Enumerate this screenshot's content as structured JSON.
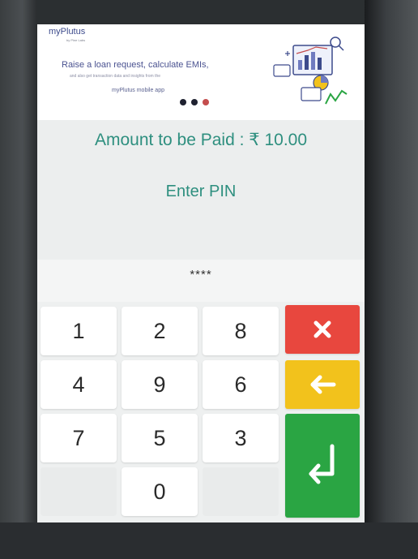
{
  "banner": {
    "brand": "myPlutus",
    "brand_sub": "by Pine Labs",
    "tagline": "Raise a loan request, calculate EMIs,",
    "tagline_sub": "and also get transaction data and insights from the",
    "app_line": "myPlutus mobile app",
    "carousel_active_index": 2,
    "carousel_count": 3
  },
  "payment": {
    "amount_label": "Amount to be Paid : ₹ 10.00",
    "enter_pin_label": "Enter PIN",
    "pin_mask": "****"
  },
  "keypad": {
    "keys": [
      "1",
      "2",
      "8",
      "4",
      "9",
      "6",
      "7",
      "5",
      "3",
      "0"
    ],
    "cancel_icon": "close-icon",
    "backspace_icon": "arrow-left-icon",
    "enter_icon": "enter-return-icon"
  },
  "colors": {
    "accent_text": "#2e8f7f",
    "cancel": "#e8473e",
    "backspace": "#f2c21c",
    "enter": "#2aa543",
    "carousel_active": "#c44d4d"
  }
}
